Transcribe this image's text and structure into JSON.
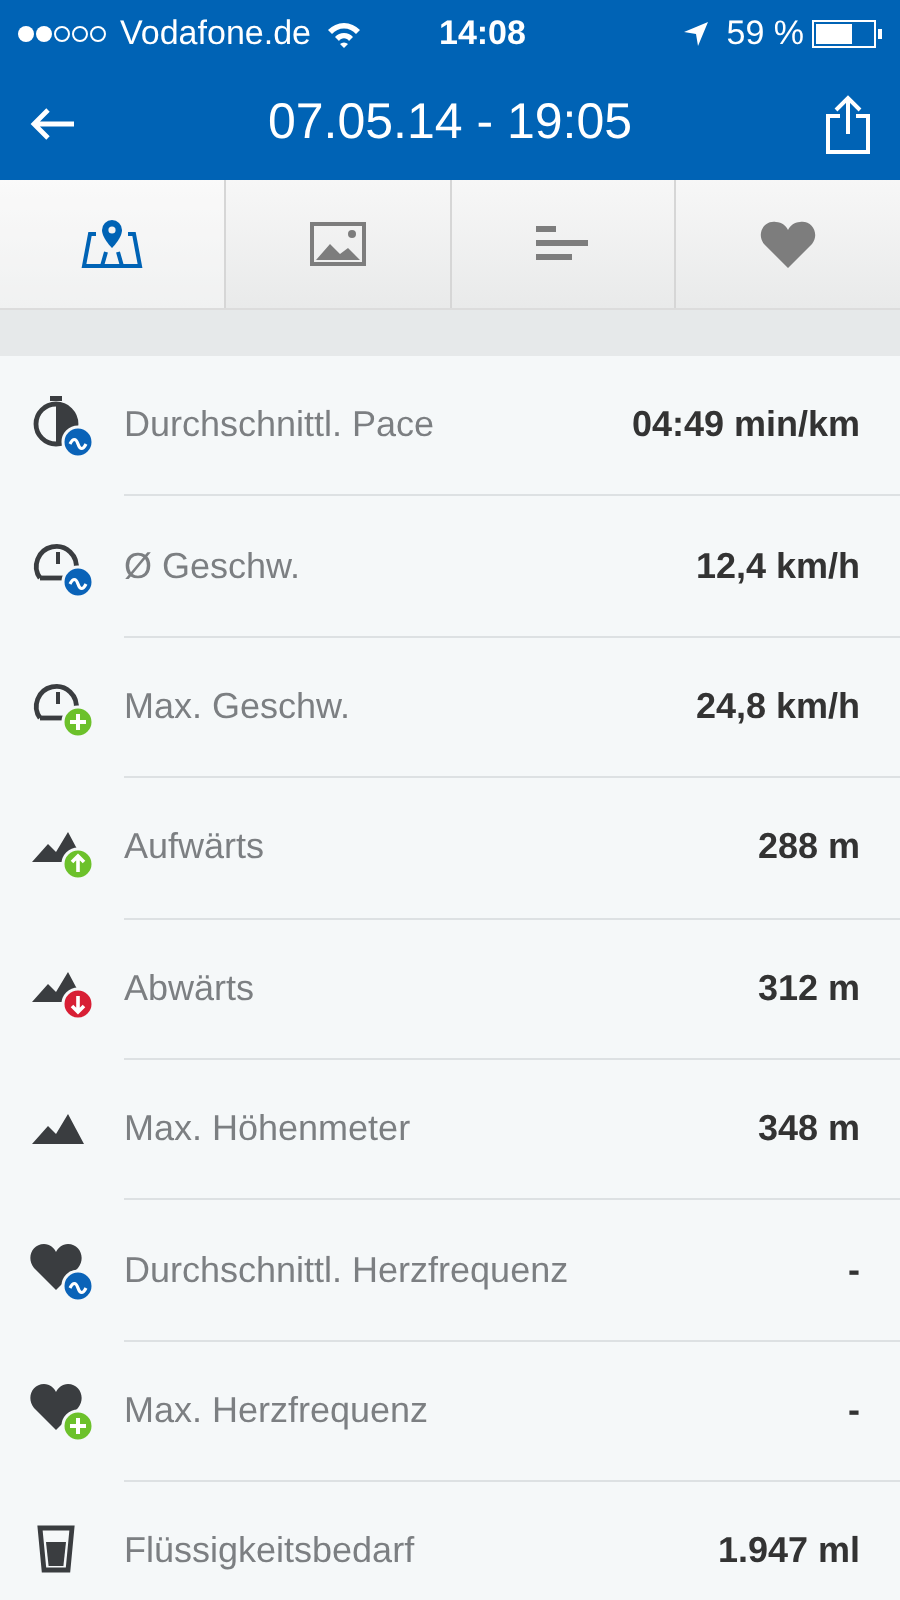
{
  "status_bar": {
    "carrier": "Vodafone.de",
    "time": "14:08",
    "battery": "59 %"
  },
  "header": {
    "title": "07.05.14 - 19:05"
  },
  "tabs": [
    {
      "kind": "map",
      "selected": true
    },
    {
      "kind": "image",
      "selected": false
    },
    {
      "kind": "list",
      "selected": false
    },
    {
      "kind": "heart",
      "selected": false
    }
  ],
  "stats": [
    {
      "kind": "pace",
      "label": "Durchschnittl. Pace",
      "value": "04:49 min/km"
    },
    {
      "kind": "avgspeed",
      "label": "Ø Geschw.",
      "value": "12,4 km/h"
    },
    {
      "kind": "maxspeed",
      "label": "Max. Geschw.",
      "value": "24,8 km/h"
    },
    {
      "kind": "ascent",
      "label": "Aufwärts",
      "value": "288 m"
    },
    {
      "kind": "descent",
      "label": "Abwärts",
      "value": "312 m"
    },
    {
      "kind": "altitude",
      "label": "Max. Höhenmeter",
      "value": "348 m"
    },
    {
      "kind": "avgheart",
      "label": "Durchschnittl. Herzfrequenz",
      "value": "-"
    },
    {
      "kind": "maxheart",
      "label": "Max. Herzfrequenz",
      "value": "-"
    },
    {
      "kind": "fluid",
      "label": "Flüssigkeitsbedarf",
      "value": "1.947 ml"
    }
  ]
}
